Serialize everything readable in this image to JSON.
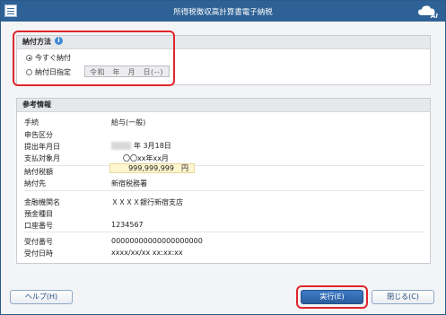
{
  "window": {
    "title": "所得税徴収高計算書電子納税",
    "brand": "AI"
  },
  "payment_method": {
    "heading": "納付方法",
    "options": [
      {
        "label": "今すぐ納付",
        "checked": true
      },
      {
        "label": "納付日指定",
        "checked": false
      }
    ],
    "date_placeholder": "令和　年　月　日(--)"
  },
  "reference": {
    "heading": "参考情報",
    "rows": [
      {
        "label": "手続",
        "value": "給与(一般)"
      },
      {
        "label": "申告区分",
        "value": ""
      },
      {
        "label": "提出年月日",
        "value": "年 3月18日"
      },
      {
        "label": "支払対象月",
        "value": "〇〇xx年xx月"
      },
      {
        "label": "納付税額",
        "value": "999,999,999　円"
      },
      {
        "label": "納付先",
        "value": "新宿税務署"
      },
      {
        "label": "金融機関名",
        "value": "ＸＸＸＸ銀行新宿支店"
      },
      {
        "label": "預金種目",
        "value": ""
      },
      {
        "label": "口座番号",
        "value": "1234567"
      },
      {
        "label": "受付番号",
        "value": "00000000000000000000"
      },
      {
        "label": "受付日時",
        "value": "xxxx/xx/xx xx:xx:xx"
      }
    ]
  },
  "buttons": {
    "help": "ヘルプ(H)",
    "execute": "実行(E)",
    "close": "閉じる(C)"
  }
}
